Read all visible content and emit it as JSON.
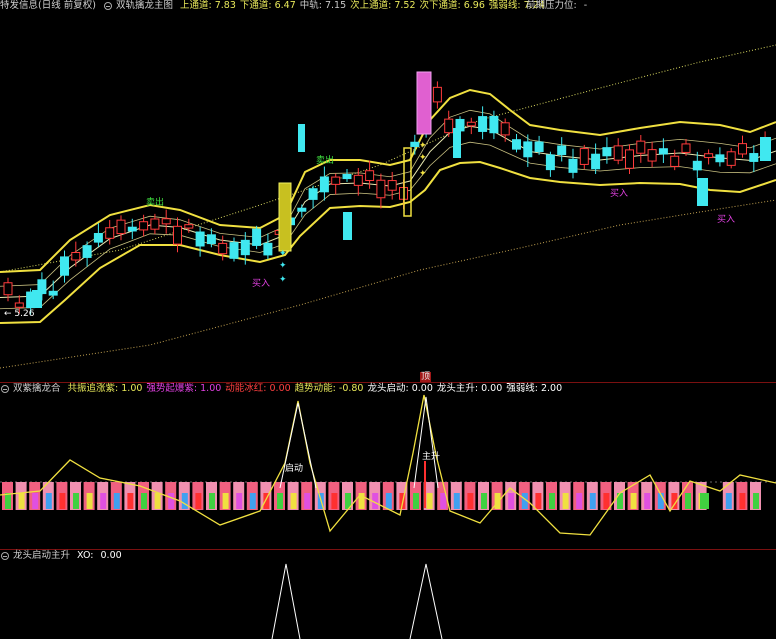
{
  "main": {
    "title": "特发信息(日线 前复权)",
    "indicator_name": "双轨擒龙主图",
    "stats": [
      {
        "label": "上通道:",
        "value": "7.83",
        "color": "#e8e85a"
      },
      {
        "label": "下通道:",
        "value": "6.47",
        "color": "#e8e85a"
      },
      {
        "label": "中轨:",
        "value": "7.15",
        "color": "#c8c8c8"
      },
      {
        "label": "次上通道:",
        "value": "7.52",
        "color": "#e8e85a"
      },
      {
        "label": "次下通道:",
        "value": "6.96",
        "color": "#e8e85a"
      },
      {
        "label": "强弱线:",
        "value": "7.24",
        "color": "#e8e85a"
      }
    ],
    "resistance_label": "前期压力位:",
    "resistance_value": "-",
    "low_marker": "← 5.26",
    "signals": {
      "sell1": "卖出",
      "sell2": "卖出",
      "buy1": "买入",
      "buy2": "买入",
      "buy3": "买入"
    },
    "mid_marker": "顶"
  },
  "sub1": {
    "indicator_name": "双紫擒龙合",
    "stats": [
      {
        "label": "共振追涨紫:",
        "value": "1.00",
        "color": "#e8e85a"
      },
      {
        "label": "强势起爆紫:",
        "value": "1.00",
        "color": "#e040e0"
      },
      {
        "label": "动能冰红:",
        "value": "0.00",
        "color": "#ff4040"
      },
      {
        "label": "趋势动能:",
        "value": "-0.80",
        "color": "#e8e85a"
      },
      {
        "label": "龙头启动:",
        "value": "0.00",
        "color": "#ffffff"
      },
      {
        "label": "龙头主升:",
        "value": "0.00",
        "color": "#ffffff"
      },
      {
        "label": "强弱线:",
        "value": "2.00",
        "color": "#ffffff"
      }
    ],
    "label_start": "启动",
    "label_rise": "主升"
  },
  "sub2": {
    "indicator_name": "龙头启动主升",
    "stat_label": "XO:",
    "stat_value": "0.00"
  },
  "colors": {
    "up": "#ff3b3b",
    "down": "#40e8f0",
    "channel": "#f0e040",
    "mid": "#e8e8b0",
    "dotted": "#d8d860",
    "background": "#000000"
  }
}
